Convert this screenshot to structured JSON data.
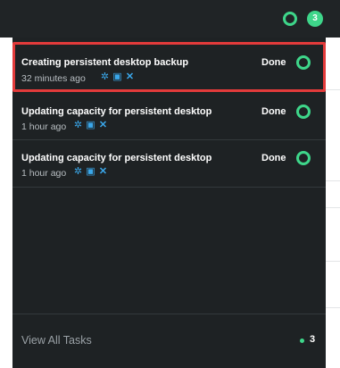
{
  "header": {
    "status_icon": "ring-icon",
    "task_count": "3"
  },
  "tasks": [
    {
      "title": "Creating persistent desktop backup",
      "time": "32 minutes ago",
      "status": "Done",
      "actions": [
        "gear-icon",
        "window-icon",
        "close-icon"
      ],
      "highlighted": true
    },
    {
      "title": "Updating capacity for persistent desktop",
      "time": "1 hour ago",
      "status": "Done",
      "actions": [
        "gear-icon",
        "window-icon",
        "close-icon"
      ],
      "highlighted": false
    },
    {
      "title": "Updating capacity for persistent desktop",
      "time": "1 hour ago",
      "status": "Done",
      "actions": [
        "gear-icon",
        "window-icon",
        "close-icon"
      ],
      "highlighted": false
    }
  ],
  "footer": {
    "view_all_label": "View All Tasks",
    "count": "3"
  },
  "colors": {
    "accent_green": "#3ed68a",
    "action_blue": "#3aa7ea",
    "highlight_red": "#e33b3b",
    "panel_bg": "#1e2224"
  }
}
